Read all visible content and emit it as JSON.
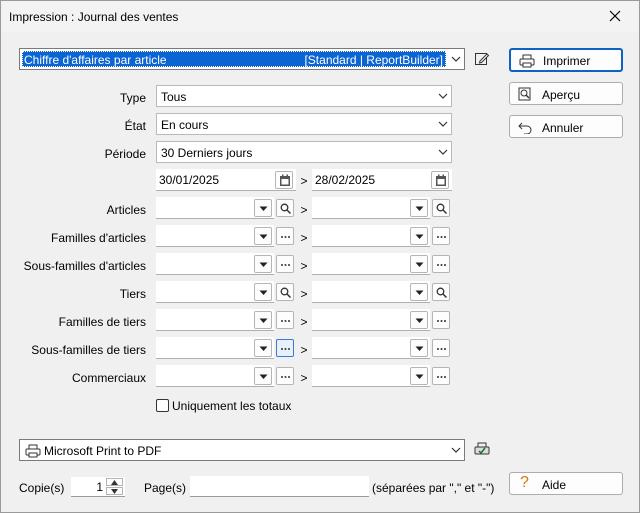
{
  "window": {
    "title": "Impression : Journal des ventes"
  },
  "report": {
    "name": "Chiffre d'affaires par article",
    "engine": "[Standard | ReportBuilder]"
  },
  "buttons": {
    "print": "Imprimer",
    "preview": "Aperçu",
    "cancel": "Annuler",
    "help": "Aide"
  },
  "filters": {
    "type": {
      "label": "Type",
      "value": "Tous"
    },
    "state": {
      "label": "État",
      "value": "En cours"
    },
    "period": {
      "label": "Période",
      "value": "30 Derniers jours"
    },
    "date_from": "30/01/2025",
    "date_to": "28/02/2025",
    "range_separator": ">"
  },
  "ranges": [
    {
      "label": "Articles",
      "button": "search"
    },
    {
      "label": "Familles d'articles",
      "button": "more"
    },
    {
      "label": "Sous-familles d'articles",
      "button": "more"
    },
    {
      "label": "Tiers",
      "button": "search"
    },
    {
      "label": "Familles de tiers",
      "button": "more"
    },
    {
      "label": "Sous-familles de tiers",
      "button": "more"
    },
    {
      "label": "Commerciaux",
      "button": "more"
    }
  ],
  "options": {
    "totals_only_label": "Uniquement les totaux",
    "totals_only_checked": false
  },
  "printer": {
    "name": "Microsoft Print to PDF"
  },
  "copies": {
    "label": "Copie(s)",
    "value": "1"
  },
  "pages": {
    "label": "Page(s)",
    "value": "",
    "hint": "(séparées par \",\" et \"-\")"
  }
}
